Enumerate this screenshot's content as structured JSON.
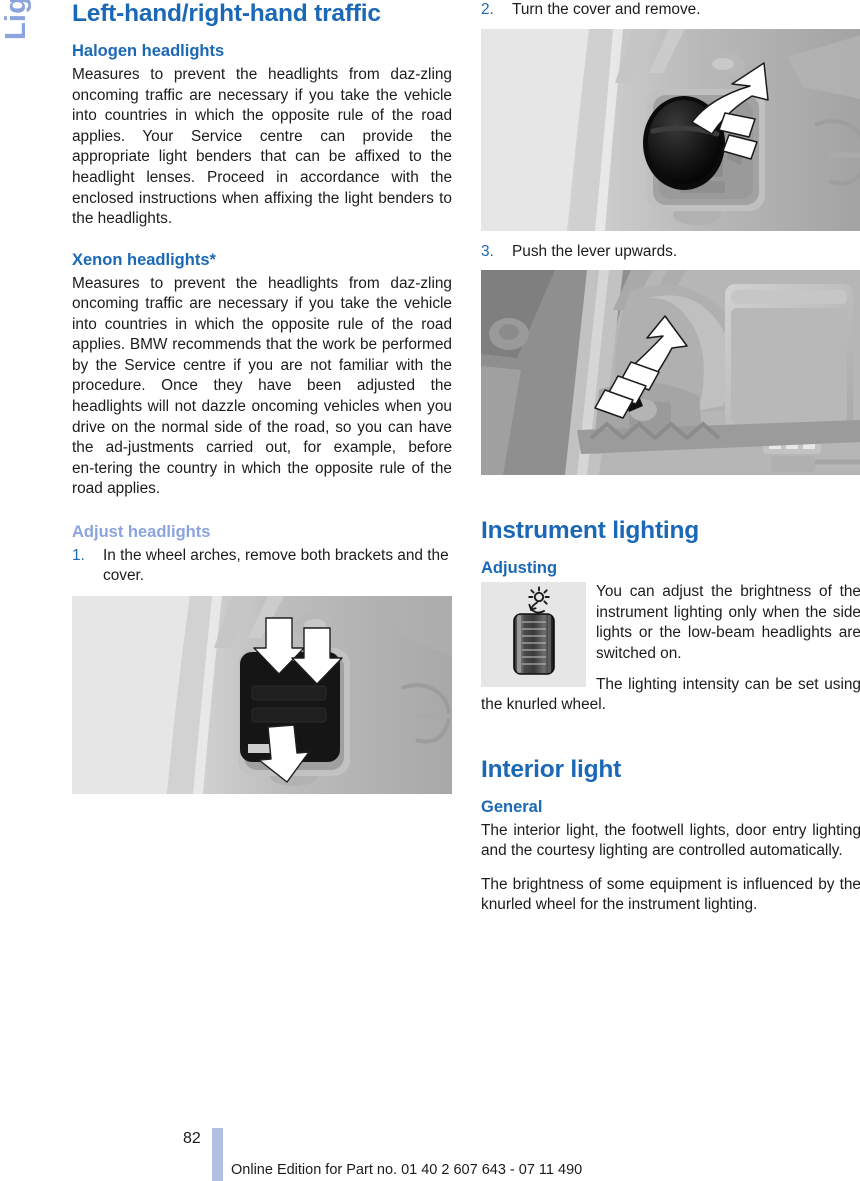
{
  "chapter_tab": {
    "label": "Lights",
    "color": "#8ba4dd"
  },
  "theme": {
    "heading_blue": "#1b69b6",
    "light_blue": "#8ba4dd",
    "body_black": "#1c1c1c",
    "figure_bg": "#e6e6e6"
  },
  "left_column": {
    "section_title": "Left-hand/right-hand traffic",
    "halogen": {
      "heading": "Halogen headlights",
      "paragraph": "Measures to prevent the headlights from daz‑zling oncoming traffic are necessary if you take the vehicle into countries in which the opposite rule of the road applies. Your Service centre can provide the appropriate light benders that can be affixed to the headlight lenses. Proceed in accordance with the enclosed instructions when affixing the light benders to the headlights."
    },
    "xenon": {
      "heading": "Xenon headlights*",
      "paragraph": "Measures to prevent the headlights from daz‑zling oncoming traffic are necessary if you take the vehicle into countries in which the opposite rule of the road applies. BMW recommends that the work be performed by the Service centre if you are not familiar with the procedure. Once they have been adjusted the headlights will not dazzle oncoming vehicles when you drive on the normal side of the road, so you can have the ad‑justments carried out, for example, before en‑tering the country in which the opposite rule of the road applies."
    },
    "adjust": {
      "heading": "Adjust headlights",
      "steps": [
        {
          "num": "1.",
          "text": "In the wheel arches, remove both brackets and the cover."
        }
      ]
    },
    "figure_1": {
      "name": "wheel-arch-cover-illustration",
      "caption_step": "1",
      "description": "Wheel arch liner with black rectangular cover, two downward white arrows on brackets and one white arrow at lower tab"
    }
  },
  "right_column": {
    "steps": [
      {
        "num": "2.",
        "text": "Turn the cover and remove."
      },
      {
        "num": "3.",
        "text": "Push the lever upwards."
      }
    ],
    "figure_2": {
      "name": "turn-cover-illustration",
      "description": "Headlight housing rear with round black cap and white rotation arrow"
    },
    "figure_3": {
      "name": "push-lever-illustration",
      "description": "Headlight housing with small black lever and white upward arrow, control module box at right"
    },
    "instrument_lighting": {
      "section_title": "Instrument lighting",
      "sub_heading": "Adjusting",
      "icon_name": "knurled-wheel-icon",
      "paragraph_1": "You can adjust the brightness of the instrument lighting only when the side lights or the low-beam headlights are switched on.",
      "paragraph_2": "The lighting intensity can be set using the knurled wheel."
    },
    "interior_light": {
      "section_title": "Interior light",
      "sub_heading": "General",
      "paragraph_1": "The interior light, the footwell lights, door entry lighting and the courtesy lighting are controlled automatically.",
      "paragraph_2": "The brightness of some equipment is influenced by the knurled wheel for the instrument lighting."
    }
  },
  "footer": {
    "page_number": "82",
    "note": "Online Edition for Part no. 01 40 2 607 643 - 07 11 490"
  }
}
